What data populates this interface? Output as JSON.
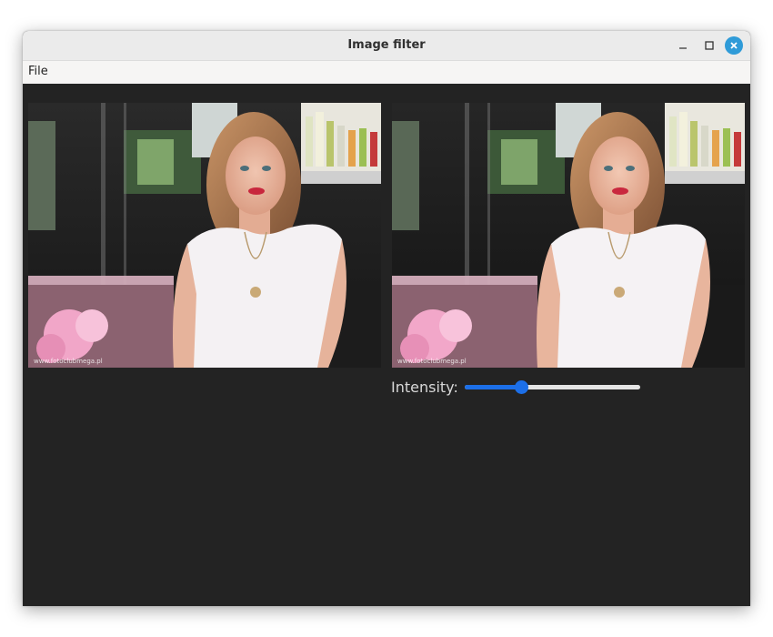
{
  "window": {
    "title": "Image filter",
    "controls": {
      "minimize_icon": "minimize-icon",
      "maximize_icon": "maximize-icon",
      "close_icon": "close-icon"
    },
    "accent_color": "#2f9bd8"
  },
  "menubar": {
    "items": [
      {
        "label": "File"
      }
    ]
  },
  "images": {
    "original": {
      "watermark": "www.fotoclubmega.pl"
    },
    "filtered": {
      "watermark": "www.fotoclubmega.pl"
    }
  },
  "controls": {
    "intensity_label": "Intensity:",
    "intensity_value": 0.32,
    "slider_color": "#1c6fe8"
  }
}
